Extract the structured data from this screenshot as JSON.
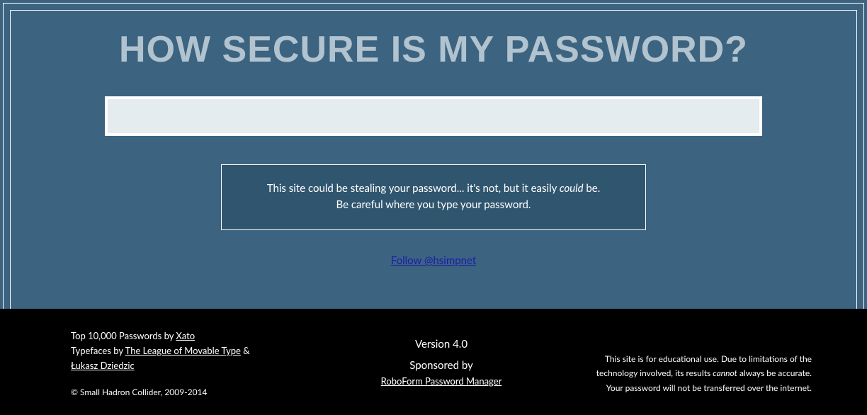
{
  "title": "HOW SECURE IS MY PASSWORD?",
  "password_value": "",
  "warning": {
    "line1_pre": "This site could be stealing your password... it's not, but it easily ",
    "line1_em": "could",
    "line1_post": " be.",
    "line2": "Be careful where you type your password."
  },
  "follow_link": "Follow @hsimpnet",
  "footer": {
    "left": {
      "passwords_pre": "Top 10,000 Passwords by ",
      "passwords_link": "Xato",
      "typefaces_pre": "Typefaces by ",
      "typefaces_link1": "The League of Movable Type",
      "typefaces_amp": " & ",
      "typefaces_link2": "Łukasz Dziedzic",
      "copyright": "© Small Hadron Collider, 2009-2014"
    },
    "center": {
      "version": "Version 4.0",
      "sponsored_label": "Sponsored by",
      "sponsor_link": "RoboForm Password Manager"
    },
    "right": {
      "l1": "This site is for educational use. Due to limitations of the",
      "l2_pre": "technology involved, its results ",
      "l2_em": "cannot",
      "l2_post": " always be accurate.",
      "l3": "Your password will not be transferred over the internet."
    }
  }
}
